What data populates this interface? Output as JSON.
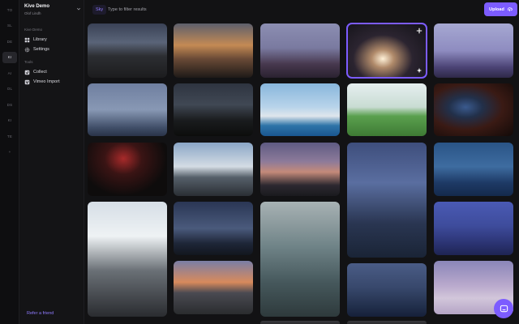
{
  "rail": [
    "TO",
    "SL",
    "DE",
    "KI",
    "AI",
    "OL",
    "DS",
    "KI",
    "TE",
    "+"
  ],
  "rail_active_index": 3,
  "workspace": {
    "name": "Kive Demo",
    "user": "Olof Lindh"
  },
  "sidebar": {
    "section_main": "Kive Demo",
    "items": [
      {
        "label": "Library",
        "icon": "grid-icon"
      },
      {
        "label": "Settings",
        "icon": "gear-icon"
      }
    ],
    "section_tools": "Tools",
    "tools": [
      {
        "label": "Collect",
        "icon": "collect-icon"
      },
      {
        "label": "Vimeo Import",
        "icon": "vimeo-icon"
      }
    ],
    "refer": "Refer a friend"
  },
  "search": {
    "chip": "Sky",
    "placeholder": "Type to filter results"
  },
  "upload_label": "Upload",
  "colors": {
    "accent": "#7c5cff",
    "background": "#121214",
    "sidebar": "#141416"
  },
  "grid": [
    {
      "name": "photo-village-road-dusk",
      "bg": "linear-gradient(180deg,#3a4256 0%,#5a6478 35%,#2c2e32 60%,#1c1c1e 100%)"
    },
    {
      "name": "photo-silhouette-sunset",
      "bg": "linear-gradient(180deg,#5d5f6c 0%,#c48a54 40%,#6a4a36 65%,#1e1a18 100%)"
    },
    {
      "name": "photo-foggy-trees",
      "bg": "linear-gradient(180deg,#8c8eb2 0%,#7a7aa0 45%,#47384e 75%,#2a2230 100%)"
    },
    {
      "name": "photo-light-beam-night",
      "bg": "radial-gradient(ellipse at 45% 65%,#fff1d8 0%,#b08a6a 18%,#2b2430 48%,#111116 100%)",
      "selected": true,
      "expand": true
    },
    {
      "name": "photo-purple-fog-field",
      "bg": "linear-gradient(180deg,#a6a8d2 0%,#8e8cc0 50%,#4c4476 80%,#2e2848 100%)"
    },
    {
      "name": "photo-misty-horizon",
      "bg": "linear-gradient(180deg,#6f7fa0 0%,#8898b4 50%,#3e4c66 85%,#2a3348 100%)"
    },
    {
      "name": "photo-night-car-lights",
      "bg": "linear-gradient(180deg,#2e3440 0%,#404854 40%,#1a1c1e 70%,#0c0d0c 100%)"
    },
    {
      "name": "photo-coastal-town",
      "bg": "linear-gradient(180deg,#88b6dc 0%,#b8d4ea 45%,#dfe6ec 62%,#2e74a8 80%,#1a5690 100%)"
    },
    {
      "name": "photo-green-hill",
      "bg": "linear-gradient(180deg,#e6eef0 0%,#c8dcd2 45%,#5aa04e 62%,#3e7a34 100%)"
    },
    {
      "name": "photo-airplane-window",
      "bg": "radial-gradient(ellipse at 40% 45%,#3a5a8e 0%,#22304a 25%,#3a1a14 55%,#120a08 100%)"
    },
    {
      "name": "photo-red-drone-lights",
      "bg": "radial-gradient(ellipse at 45% 30%,#a82a2a 0%,#3a1414 30%,#0e0c0c 70%)"
    },
    {
      "name": "photo-person-shore",
      "bg": "linear-gradient(180deg,#8aa6c6 0%,#d4dce4 45%,#56606a 65%,#2a2e34 100%)"
    },
    {
      "name": "photo-power-lines-dusk",
      "bg": "linear-gradient(180deg,#5e5a82 0%,#8c7a9a 35%,#c48a7a 55%,#2c2830 80%,#1a1a1e 100%)"
    },
    {
      "name": "photo-camera-crew-night",
      "bg": "linear-gradient(180deg,#3e4e7c 0%,#5a6ea0 35%,#2a3652 70%,#1a2436 100%)"
    },
    {
      "name": "photo-blue-valley",
      "bg": "linear-gradient(180deg,#2a5486 0%,#3e6ca0 45%,#1e3a66 75%,#142a4c 100%)"
    },
    {
      "name": "photo-film-set-light",
      "bg": "linear-gradient(180deg,#d6dee6 0%,#eef2f4 30%,#6a7076 60%,#2a2c30 100%)"
    },
    {
      "name": "photo-dark-horizon",
      "bg": "linear-gradient(180deg,#2a3654 0%,#4a5a7c 50%,#1e2638 78%,#12161e 100%)"
    },
    {
      "name": "photo-aerial-river",
      "bg": "linear-gradient(180deg,#a8b2b4 0%,#6e8286 40%,#46585c 70%,#2e3a3c 100%)"
    },
    {
      "name": "photo-blue-lake-dusk",
      "bg": "linear-gradient(180deg,#4a5c86 0%,#38486c 45%,#22304c 80%,#16203a 100%)"
    },
    {
      "name": "photo-blue-trees",
      "bg": "linear-gradient(180deg,#4a5ab4 0%,#3e4c9c 45%,#2a3270 80%,#1e2452 100%)"
    },
    {
      "name": "photo-sunset-village",
      "bg": "linear-gradient(180deg,#7a7ea6 0%,#d88a5c 40%,#4a4a52 60%,#2a2c2e 100%)"
    },
    {
      "name": "photo-pink-fog-poles",
      "bg": "linear-gradient(180deg,#8a86b8 0%,#b8a8cc 45%,#d2c6da 70%,#b4a4c6 100%)"
    },
    {
      "name": "photo-strip-1",
      "bg": "linear-gradient(180deg,#3a3a3e,#222224)"
    },
    {
      "name": "photo-strip-2",
      "bg": "linear-gradient(180deg,#3a3a3e,#222224)"
    }
  ]
}
